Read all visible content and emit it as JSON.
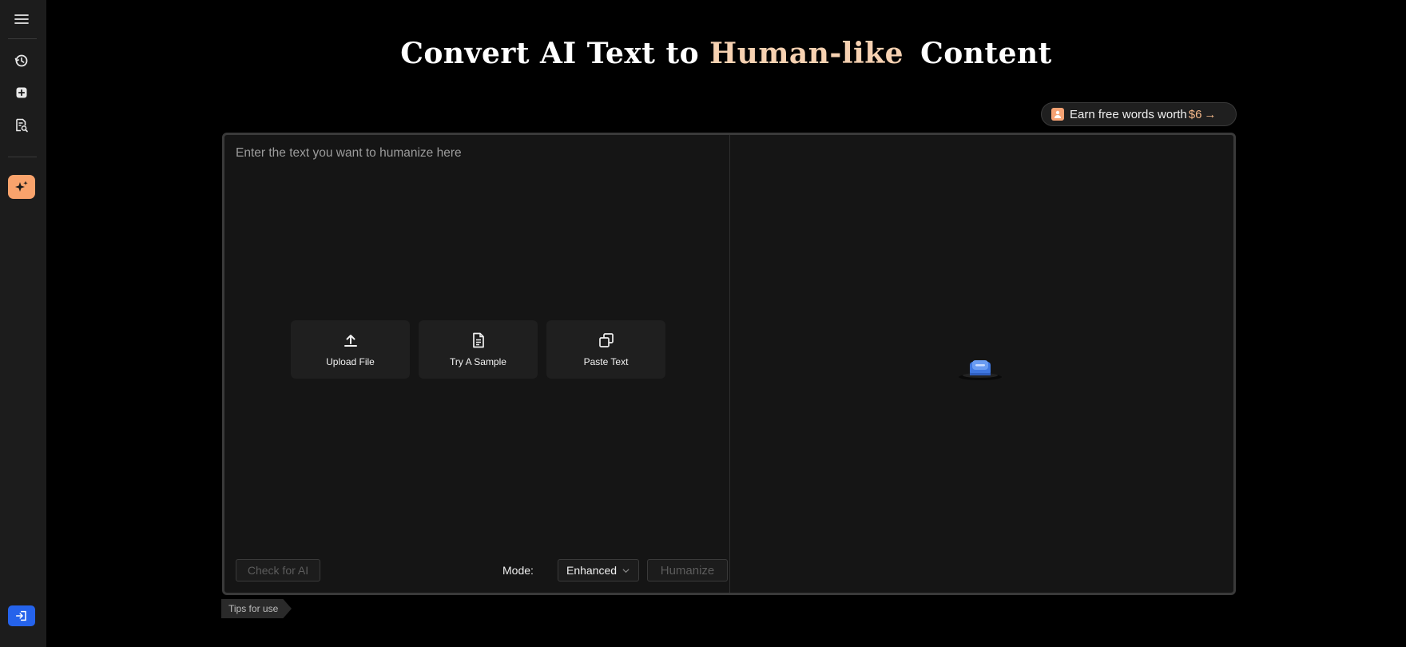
{
  "sidebar": {
    "items": [
      {
        "name": "menu",
        "icon": "hamburger-icon"
      },
      {
        "name": "history",
        "icon": "history-icon"
      },
      {
        "name": "new",
        "icon": "add-square-icon"
      },
      {
        "name": "detector",
        "icon": "doc-search-icon"
      },
      {
        "name": "humanizer",
        "icon": "sparkle-icon",
        "active": true
      },
      {
        "name": "login",
        "icon": "login-icon"
      }
    ],
    "accent_color": "#f9a36c",
    "login_color": "#2563eb"
  },
  "header": {
    "title_prefix": "Convert AI Text to",
    "title_highlight": "Human-like",
    "title_suffix": "Content",
    "highlight_color": "#f6d1b1"
  },
  "promo": {
    "text": "Earn free words worth",
    "amount": "$6",
    "arrow": "→"
  },
  "editor": {
    "input_placeholder": "Enter the text you want to humanize here",
    "input_value": "",
    "actions": [
      {
        "label": "Upload File",
        "icon": "upload-icon"
      },
      {
        "label": "Try A Sample",
        "icon": "document-icon"
      },
      {
        "label": "Paste Text",
        "icon": "copy-icon"
      }
    ],
    "check_button": "Check for AI",
    "mode_label": "Mode:",
    "mode_value": "Enhanced",
    "humanize_button": "Humanize"
  },
  "tips": {
    "label": "Tips for use"
  }
}
